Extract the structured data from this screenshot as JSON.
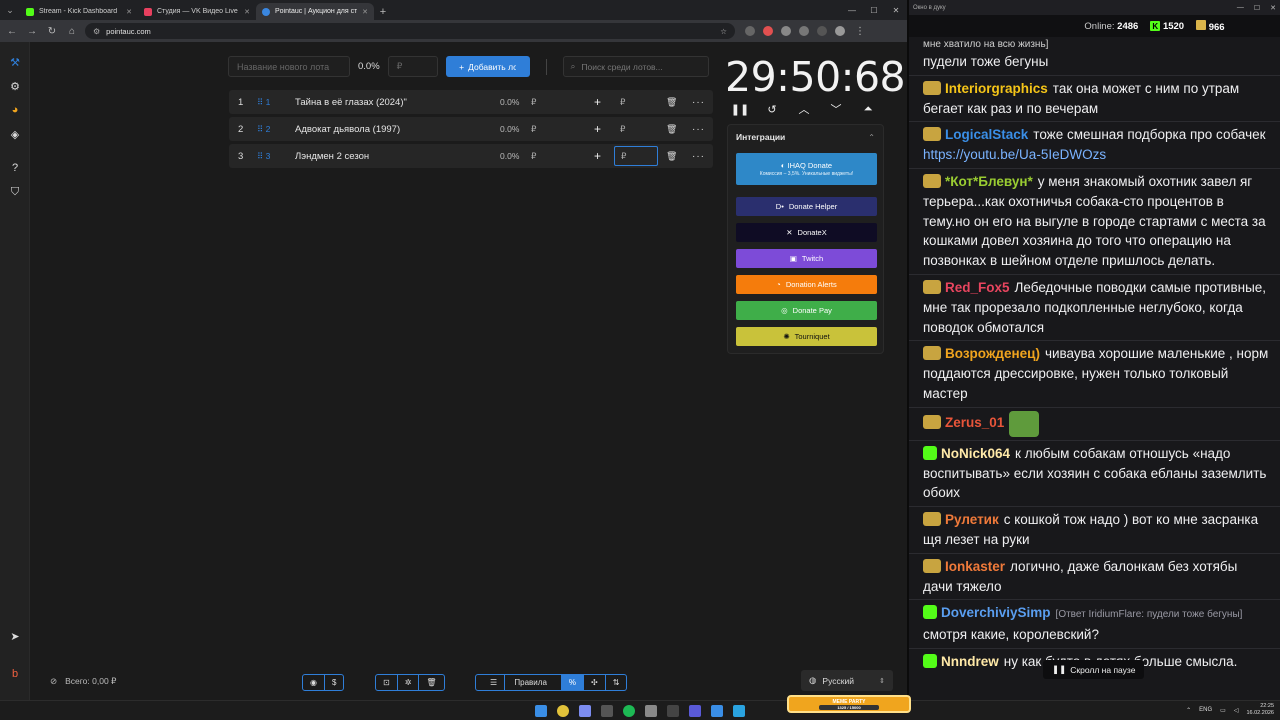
{
  "browser": {
    "tabs": [
      {
        "label": "Stream - Kick Dashboard",
        "color": "#53fc18"
      },
      {
        "label": "Студия — VK Видео Live",
        "color": "#e8405f"
      },
      {
        "label": "Pointauc | Аукцион для стрим",
        "color": "#3a87e0"
      }
    ],
    "url": "pointauc.com"
  },
  "app": {
    "new_lot_placeholder": "Название нового лота",
    "new_lot_pct": "0.0%",
    "currency": "₽",
    "add_button": "Добавить лот",
    "search_placeholder": "Поиск среди лотов...",
    "lots": [
      {
        "num": "1",
        "id": "1",
        "name": "Тайна в её глазах (2024)\"",
        "pct": "0.0%",
        "amount": "₽"
      },
      {
        "num": "2",
        "id": "2",
        "name": "Адвокат дьявола (1997)",
        "pct": "0.0%",
        "amount": "₽"
      },
      {
        "num": "3",
        "id": "3",
        "name": "Лэндмен 2 сезон",
        "pct": "0.0%",
        "amount": "₽"
      }
    ],
    "timer": "29:50:68",
    "integrations": {
      "title": "Интеграции",
      "ihaq": {
        "label": "IHAQ Donate",
        "sub": "Комиссия – 3,5%. Уникальные виджеты!"
      },
      "buttons": [
        {
          "label": "Donate Helper",
          "color": "#2a2f6e"
        },
        {
          "label": "DonateX",
          "color": "#0f0c24"
        },
        {
          "label": "Twitch",
          "color": "#7d4bd8"
        },
        {
          "label": "Donation Alerts",
          "color": "#f57c0c"
        },
        {
          "label": "Donate Pay",
          "color": "#3fae49"
        },
        {
          "label": "Tourniquet",
          "color": "#c9c23a"
        }
      ]
    },
    "total": "Всего: 0,00 ₽",
    "rules_button": "Правила",
    "language": "Русский"
  },
  "chat": {
    "window_title": "Окно в дуку",
    "online_label": "Online:",
    "online_count": "2486",
    "kick_count": "1520",
    "badge_count": "966",
    "messages": [
      {
        "user": "",
        "text": "мне хватило на всю жизнь]",
        "prefix": ""
      },
      {
        "user": "",
        "text": "пудели тоже бегуны",
        "prefix": ""
      },
      {
        "user": "Interiorgraphics",
        "color": "#f5c518",
        "text": "так она может с ним по утрам бегает как раз и по вечерам"
      },
      {
        "user": "LogicalStack",
        "color": "#3a8ee6",
        "text": "тоже смешная подборка про собачек",
        "link": "https://youtu.be/Ua-5IeDWOzs"
      },
      {
        "user": "*Кот*Блевун*",
        "color": "#9acd32",
        "text": "у меня знакомый охотник завел яг терьера...как охотничья собака-сто процентов в тему.но он его на выгуле в городе стартами с места за кошками довел хозяина до того что операцию на позвонках в шейном отделе пришлось делать."
      },
      {
        "user": "Red_Fox5",
        "color": "#e8455f",
        "text": "Лебедочные поводки самые противные, мне так прорезало подкопленные неглубоко, когда поводок обмотался"
      },
      {
        "user": "Возрожденец)",
        "color": "#f0a41e",
        "text": "чиваува хорошие маленькие , норм поддаются дрессировке, нужен только толковый мастер"
      },
      {
        "user": "Zerus_01",
        "color": "#e8553a",
        "text": ""
      },
      {
        "user": "NoNick064",
        "color": "#ffe9a8",
        "text": "к любым собакам отношусь «надо воспитывать» если хозяин с собака ебланы заземлить обоих"
      },
      {
        "user": "Рулетик",
        "color": "#f07a3a",
        "text": "с кошкой тож надо ) вот ко мне засранка щя лезет на руки"
      },
      {
        "user": "Ionkaster",
        "color": "#f07a3a",
        "text": "логично, даже балонкам без хотябы дачи тяжело"
      },
      {
        "user": "DoverchiviySimp",
        "color": "#5a9ef0",
        "reply": "[Ответ IridiumFlare: пудели тоже бегуны]",
        "text": "смотря какие, королевский?"
      },
      {
        "user": "Nnndrew",
        "color": "#ffe9a8",
        "text": "ну как будто в детях больше смысла."
      }
    ],
    "pause_label": "Скролл на паузе"
  },
  "taskbar": {
    "lang": "ENG",
    "time": "22:25",
    "date": "16.02.2026",
    "widget_title": "MEME PARTY",
    "widget_progress": "1325 / 15000"
  }
}
